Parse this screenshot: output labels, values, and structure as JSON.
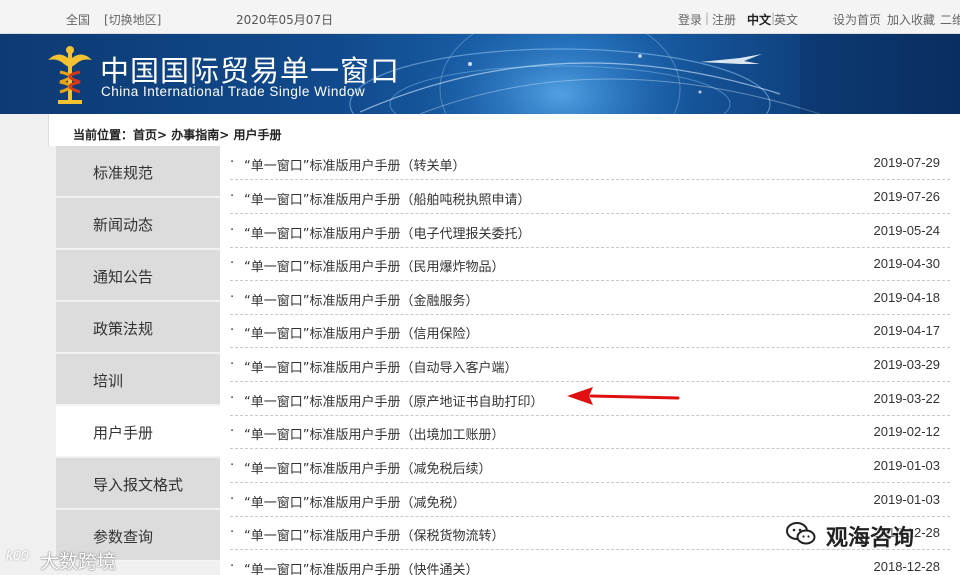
{
  "topbar": {
    "home": "全国",
    "switch_region": "[切换地区]",
    "date": "2020年05月07日",
    "login": "登录",
    "sep1": "|",
    "register": "注册",
    "lang_cn": "中文",
    "sep2": "|",
    "lang_en": "英文",
    "set_home": "设为首页",
    "add_fav": "加入收藏",
    "qrcode": "二维"
  },
  "banner": {
    "title_cn": "中国国际贸易单一窗口",
    "title_en": "China International Trade Single  Window"
  },
  "breadcrumb": {
    "text": "当前位置：首页> 办事指南> 用户手册"
  },
  "sidebar": {
    "items": [
      {
        "label": "标准规范"
      },
      {
        "label": "新闻动态"
      },
      {
        "label": "通知公告"
      },
      {
        "label": "政策法规"
      },
      {
        "label": "培训"
      },
      {
        "label": "用户手册"
      },
      {
        "label": "导入报文格式"
      },
      {
        "label": "参数查询"
      }
    ]
  },
  "list": {
    "bullet": "·",
    "rows": [
      {
        "title": "“单一窗口”标准版用户手册（转关单）",
        "date": "2019-07-29"
      },
      {
        "title": "“单一窗口”标准版用户手册（船舶吨税执照申请）",
        "date": "2019-07-26"
      },
      {
        "title": "“单一窗口”标准版用户手册（电子代理报关委托）",
        "date": "2019-05-24"
      },
      {
        "title": "“单一窗口”标准版用户手册（民用爆炸物品）",
        "date": "2019-04-30"
      },
      {
        "title": "“单一窗口”标准版用户手册（金融服务）",
        "date": "2019-04-18"
      },
      {
        "title": "“单一窗口”标准版用户手册（信用保险）",
        "date": "2019-04-17"
      },
      {
        "title": "“单一窗口”标准版用户手册（自动导入客户端）",
        "date": "2019-03-29"
      },
      {
        "title": "“单一窗口”标准版用户手册（原产地证书自助打印）",
        "date": "2019-03-22"
      },
      {
        "title": "“单一窗口”标准版用户手册（出境加工账册）",
        "date": "2019-02-12"
      },
      {
        "title": "“单一窗口”标准版用户手册（减免税后续）",
        "date": "2019-01-03"
      },
      {
        "title": "“单一窗口”标准版用户手册（减免税）",
        "date": "2019-01-03"
      },
      {
        "title": "“单一窗口”标准版用户手册（保税货物流转）",
        "date": "2018-12-28"
      },
      {
        "title": "“单一窗口”标准版用户手册（快件通关）",
        "date": "2018-12-28"
      }
    ]
  },
  "watermark": {
    "right_text": "观海咨询",
    "left_badge": "k00",
    "left_text": "大数跨境"
  },
  "colors": {
    "banner": "#114a8c",
    "sidebar_bg": "#dcdcdc",
    "annotation_arrow": "#e01010"
  }
}
